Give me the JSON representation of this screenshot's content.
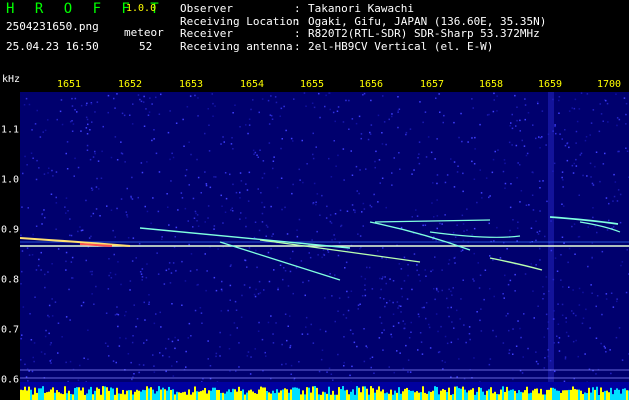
{
  "header": {
    "brand": "H R O F F T",
    "version": "1.0.0",
    "filename": "2504231650.png",
    "meteor_label": "meteor",
    "timestamp": "25.04.23 16:50",
    "meteor_count": "52",
    "info": [
      {
        "key": "Observer",
        "value": "Takanori Kawachi"
      },
      {
        "key": "Receiving Location",
        "value": "Ogaki, Gifu, JAPAN (136.60E, 35.35N)"
      },
      {
        "key": "Receiver",
        "value": "R820T2(RTL-SDR) SDR-Sharp 53.372MHz"
      },
      {
        "key": "Receiving antenna",
        "value": "2el-HB9CV Vertical (el. E-W)"
      }
    ]
  },
  "plot": {
    "y_unit": "kHz",
    "x_ticks": [
      "1651",
      "1652",
      "1653",
      "1654",
      "1655",
      "1656",
      "1657",
      "1658",
      "1659",
      "1700"
    ],
    "y_ticks": [
      "1.1",
      "1.0",
      "0.9",
      "0.8",
      "0.7",
      "0.6"
    ],
    "colors": {
      "background": "#00006e",
      "carrier": "#e8ffd8",
      "trail": "#7fffe0",
      "ticks_x": "#ffff00"
    }
  }
}
